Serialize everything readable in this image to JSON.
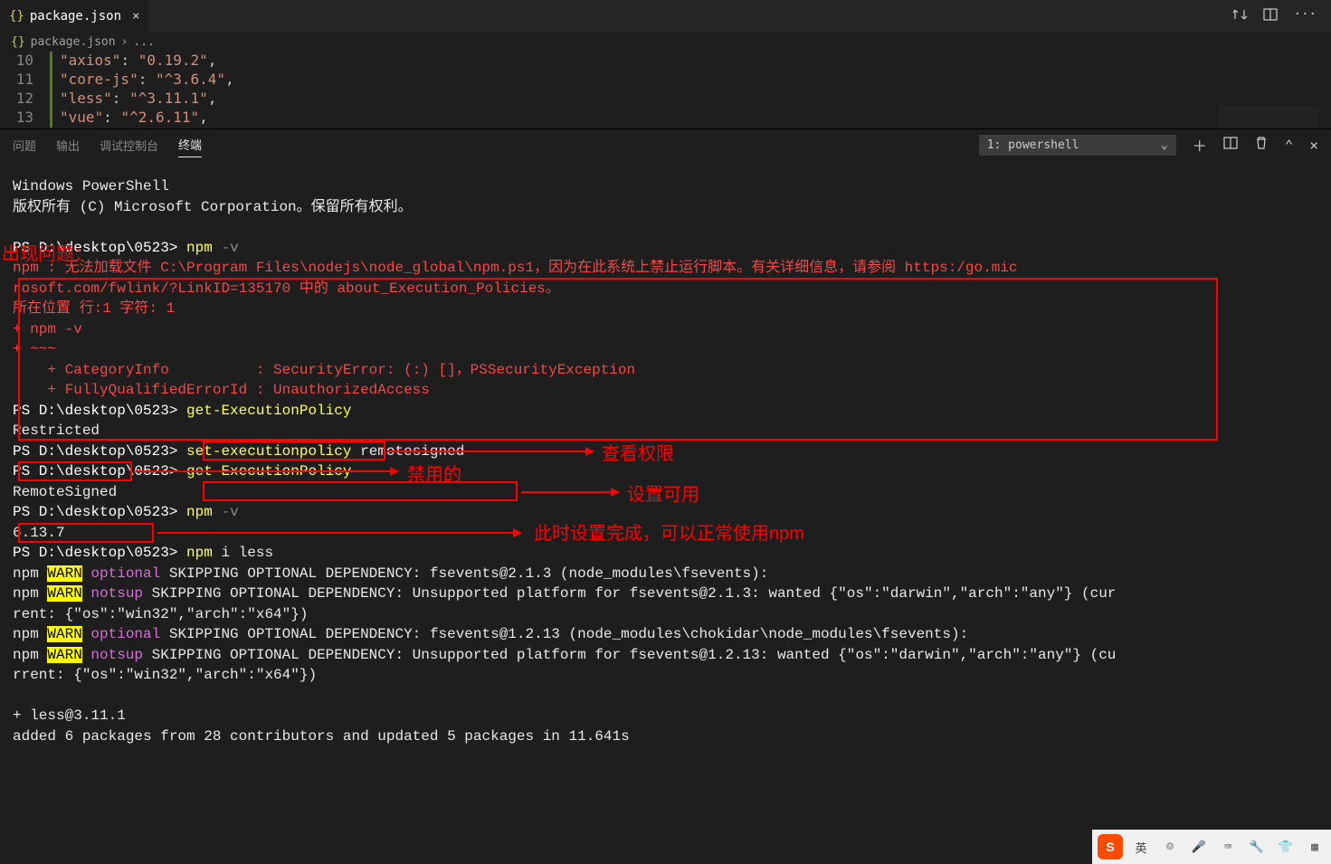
{
  "tab": {
    "icon": "{}",
    "title": "package.json"
  },
  "breadcrumb": {
    "icon": "{}",
    "file": "package.json",
    "sep": "›",
    "rest": "..."
  },
  "editor_lines": [
    {
      "num": "10",
      "content_pre": "    ",
      "k": "\"axios\"",
      "mid": ": ",
      "v": "\"0.19.2\"",
      "post": ","
    },
    {
      "num": "11",
      "content_pre": "    ",
      "k": "\"core-js\"",
      "mid": ": ",
      "v": "\"^3.6.4\"",
      "post": ","
    },
    {
      "num": "12",
      "content_pre": "    ",
      "k": "\"less\"",
      "mid": ": ",
      "v": "\"^3.11.1\"",
      "post": ","
    },
    {
      "num": "13",
      "content_pre": "    ",
      "k": "\"vue\"",
      "mid": ": ",
      "v": "\"^2.6.11\"",
      "post": ","
    }
  ],
  "panel": {
    "tabs": {
      "problems": "问题",
      "output": "输出",
      "debug": "调试控制台",
      "terminal": "终端"
    },
    "select_label": "1: powershell"
  },
  "terminal": {
    "line_ps_title": "Windows PowerShell",
    "line_copyright": "版权所有 (C) Microsoft Corporation。保留所有权利。",
    "prompt": "PS D:\\desktop\\0523>",
    "cmd_npm": "npm",
    "flag_v": "-v",
    "err_block": "npm : 无法加载文件 C:\\Program Files\\nodejs\\node_global\\npm.ps1，因为在此系统上禁止运行脚本。有关详细信息，请参阅 https:/go.mic\nrosoft.com/fwlink/?LinkID=135170 中的 about_Execution_Policies。\n所在位置 行:1 字符: 1\n+ npm -v\n+ ~~~\n    + CategoryInfo          : SecurityError: (:) []，PSSecurityException\n    + FullyQualifiedErrorId : UnauthorizedAccess",
    "cmd_get": "get-ExecutionPolicy",
    "result_restricted": "Restricted",
    "cmd_set": "set-executionpolicy",
    "cmd_set_arg": "remotesigned",
    "result_remotesigned": "RemoteSigned",
    "npm_version": "6.13.7",
    "cmd_iless": "i less",
    "warn1": "npm WARN optional SKIPPING OPTIONAL DEPENDENCY: fsevents@2.1.3 (node_modules\\fsevents):",
    "warn2": "npm WARN notsup SKIPPING OPTIONAL DEPENDENCY: Unsupported platform for fsevents@2.1.3: wanted {\"os\":\"darwin\",\"arch\":\"any\"} (cur\nrent: {\"os\":\"win32\",\"arch\":\"x64\"})",
    "warn3": "npm WARN optional SKIPPING OPTIONAL DEPENDENCY: fsevents@1.2.13 (node_modules\\chokidar\\node_modules\\fsevents):",
    "warn4": "npm WARN notsup SKIPPING OPTIONAL DEPENDENCY: Unsupported platform for fsevents@1.2.13: wanted {\"os\":\"darwin\",\"arch\":\"any\"} (cu\nrrent: {\"os\":\"win32\",\"arch\":\"x64\"})",
    "install_result": "+ less@3.11.1",
    "install_summary": "added 6 packages from 28 contributors and updated 5 packages in 11.641s"
  },
  "annotations": {
    "problem_label": "出现问题：",
    "view_perm": "查看权限",
    "disabled": "禁用的",
    "set_usable": "设置可用",
    "done": "此时设置完成，可以正常使用npm"
  },
  "taskbar": {
    "lang": "英"
  }
}
